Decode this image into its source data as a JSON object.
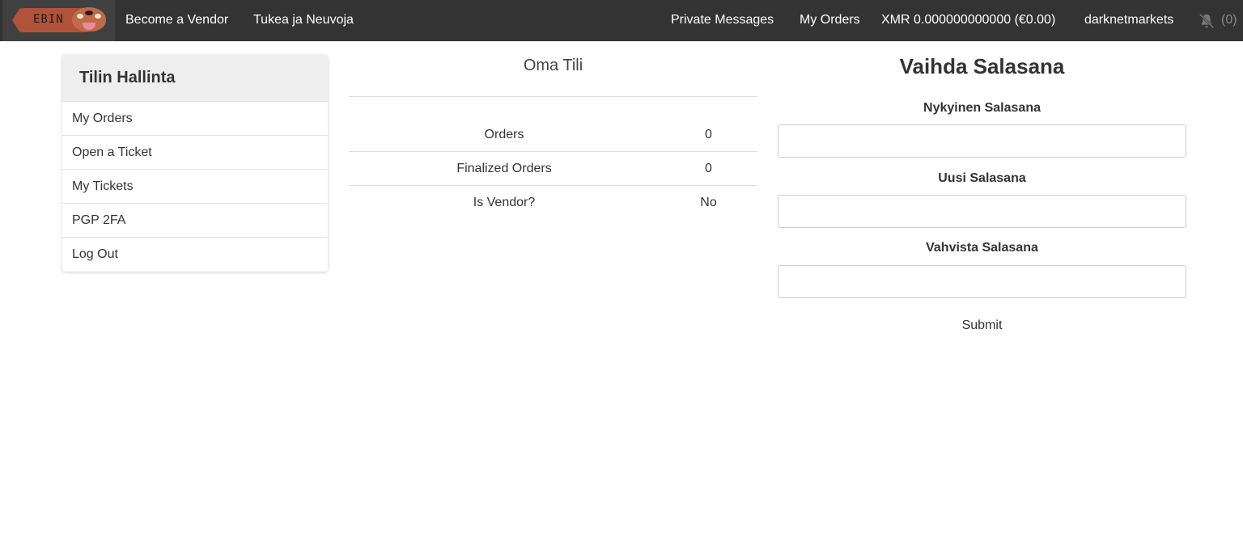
{
  "navbar": {
    "brand_text": "EBIN",
    "links": {
      "become_vendor": "Become a Vendor",
      "support": "Tukea ja Neuvoja",
      "private_messages": "Private Messages",
      "my_orders": "My Orders",
      "balance": "XMR 0.000000000000 (€0.00)",
      "username": "darknetmarkets"
    },
    "notification_count": "(0)",
    "notification_icon": "bell-muted-icon"
  },
  "sidebar": {
    "title": "Tilin Hallinta",
    "items": [
      {
        "label": "My Orders"
      },
      {
        "label": "Open a Ticket"
      },
      {
        "label": "My Tickets"
      },
      {
        "label": "PGP 2FA"
      },
      {
        "label": "Log Out"
      }
    ]
  },
  "account": {
    "title": "Oma Tili",
    "rows": [
      {
        "key": "Orders",
        "value": "0"
      },
      {
        "key": "Finalized Orders",
        "value": "0"
      },
      {
        "key": "Is Vendor?",
        "value": "No"
      }
    ]
  },
  "password_form": {
    "title": "Vaihda Salasana",
    "current_label": "Nykyinen Salasana",
    "new_label": "Uusi Salasana",
    "confirm_label": "Vahvista Salasana",
    "current_value": "",
    "new_value": "",
    "confirm_value": "",
    "submit_label": "Submit"
  }
}
